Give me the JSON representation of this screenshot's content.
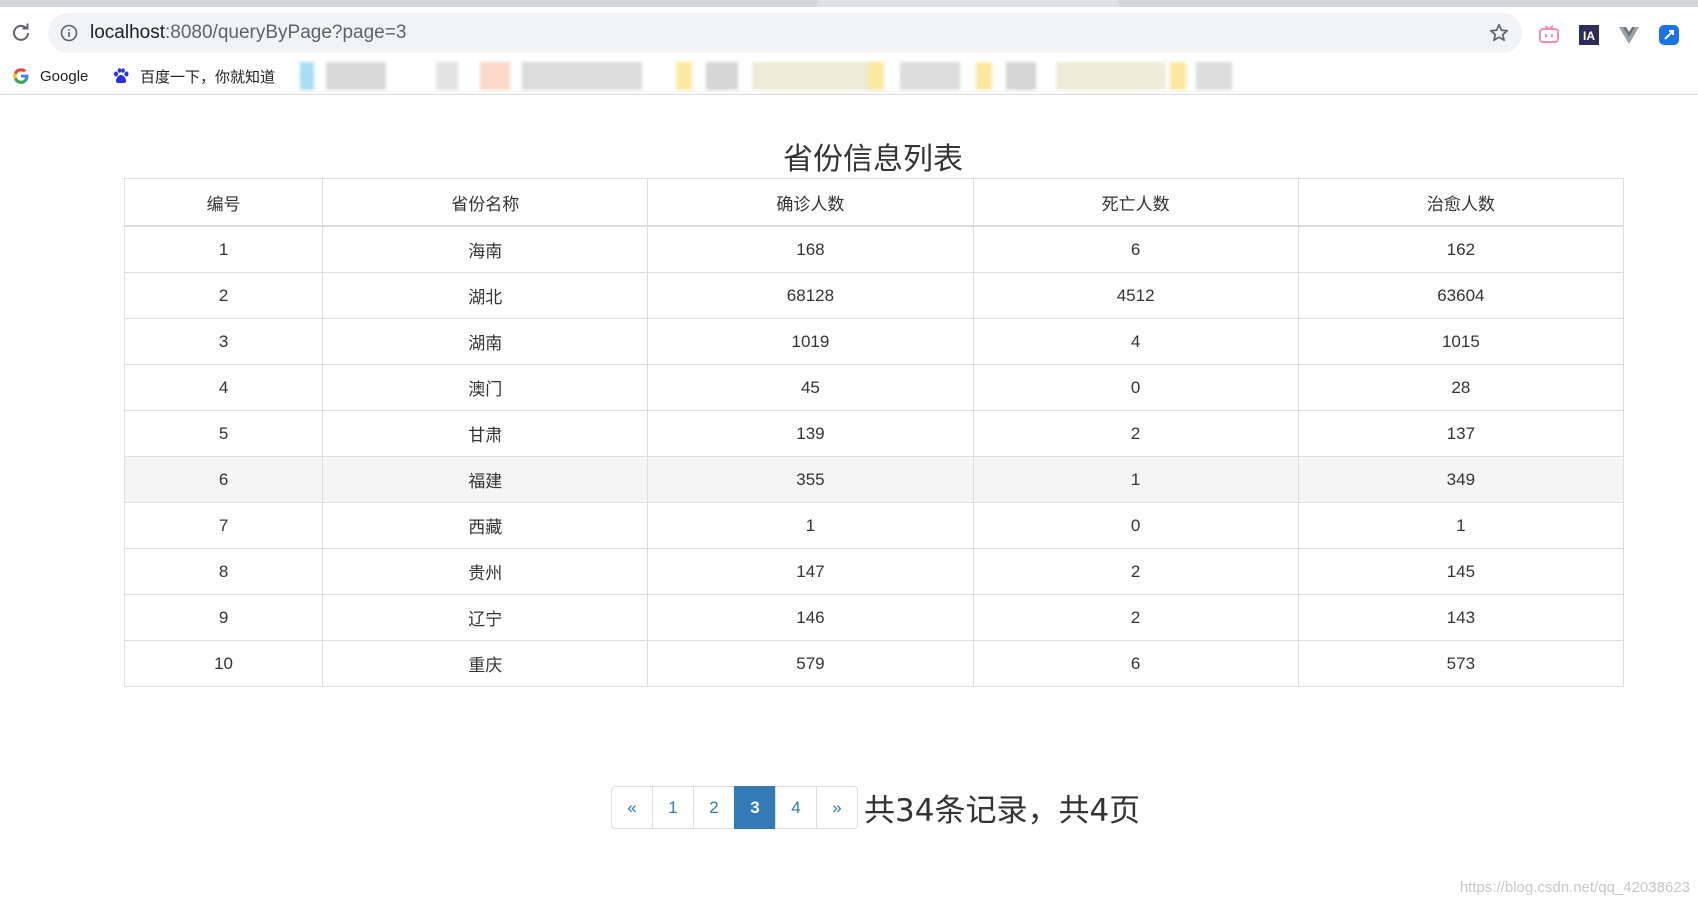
{
  "browser": {
    "url_host": "localhost",
    "url_rest": ":8080/queryByPage?page=3",
    "bookmarks": [
      {
        "label": "Google"
      },
      {
        "label": "百度一下，你就知道"
      }
    ]
  },
  "page": {
    "title": "省份信息列表"
  },
  "table": {
    "headers": [
      "编号",
      "省份名称",
      "确诊人数",
      "死亡人数",
      "治愈人数"
    ],
    "rows": [
      [
        "1",
        "海南",
        "168",
        "6",
        "162"
      ],
      [
        "2",
        "湖北",
        "68128",
        "4512",
        "63604"
      ],
      [
        "3",
        "湖南",
        "1019",
        "4",
        "1015"
      ],
      [
        "4",
        "澳门",
        "45",
        "0",
        "28"
      ],
      [
        "5",
        "甘肃",
        "139",
        "2",
        "137"
      ],
      [
        "6",
        "福建",
        "355",
        "1",
        "349"
      ],
      [
        "7",
        "西藏",
        "1",
        "0",
        "1"
      ],
      [
        "8",
        "贵州",
        "147",
        "2",
        "145"
      ],
      [
        "9",
        "辽宁",
        "146",
        "2",
        "143"
      ],
      [
        "10",
        "重庆",
        "579",
        "6",
        "573"
      ]
    ]
  },
  "pagination": {
    "prev": "«",
    "pages": [
      "1",
      "2",
      "3",
      "4"
    ],
    "current": "3",
    "next": "»",
    "summary": "共34条记录，共4页"
  },
  "watermark": "https://blog.csdn.net/qq_42038623",
  "colors": {
    "accent": "#337ab7",
    "border": "#dddddd",
    "hover_row": "#f5f5f5"
  }
}
